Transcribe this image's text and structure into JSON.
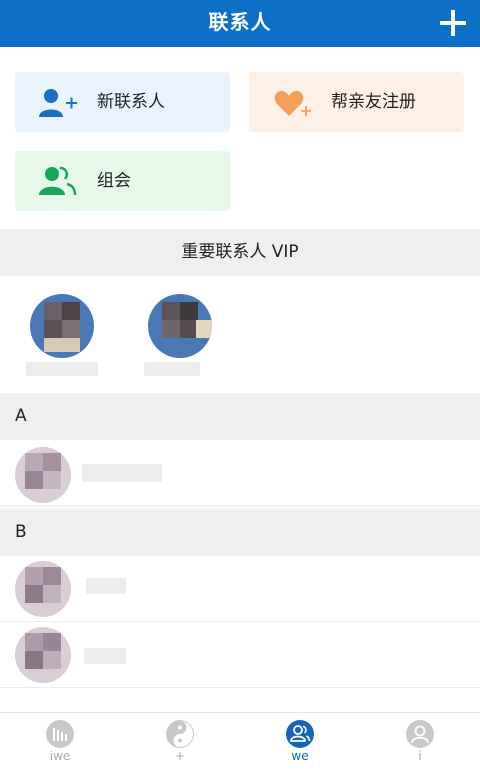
{
  "header": {
    "title": "联系人"
  },
  "actions": {
    "new_contact": "新联系人",
    "help_register": "帮亲友注册",
    "group": "组会"
  },
  "vip": {
    "title": "重要联系人 VIP"
  },
  "sections": [
    {
      "letter": "A"
    },
    {
      "letter": "B"
    }
  ],
  "tabs": [
    {
      "label": "iwe"
    },
    {
      "label": "+"
    },
    {
      "label": "we"
    },
    {
      "label": "i"
    }
  ],
  "colors": {
    "header_bg": "#0e6fc6",
    "accent": "#1565b8",
    "new_contact_card": "#e8f3fd",
    "register_card": "#fdf0e6",
    "group_card": "#e7f8ea",
    "section_bar": "#efefef"
  }
}
